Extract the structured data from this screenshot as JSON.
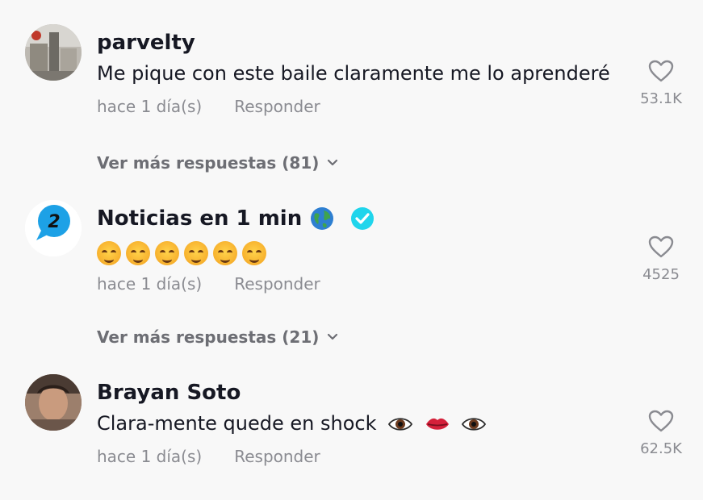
{
  "comments": [
    {
      "username": "parvelty",
      "text": "Me pique con este baile claramente me lo aprenderé",
      "time": "hace 1 día(s)",
      "reply_label": "Responder",
      "likes": "53.1K",
      "avatar": "photo-avatar",
      "more_replies": "Ver más respuestas (81)"
    },
    {
      "username": "Noticias en 1 min",
      "verified": true,
      "username_emoji": "globe-icon",
      "emoji_count": 6,
      "emoji": "smiling-face-with-hearts-icon",
      "time": "hace 1 día(s)",
      "reply_label": "Responder",
      "likes": "4525",
      "avatar": "speech-bubble-2-logo",
      "more_replies": "Ver más respuestas (21)"
    },
    {
      "username": "Brayan Soto",
      "text": "Clara-mente quede en shock",
      "text_emojis": [
        "eye-icon",
        "lips-icon",
        "eye-icon"
      ],
      "time": "hace 1 día(s)",
      "reply_label": "Responder",
      "likes": "62.5K",
      "avatar": "photo-avatar"
    }
  ],
  "colors": {
    "background": "#f8f8f8",
    "primary_text": "#161823",
    "secondary_text": "#8a8b91",
    "verified": "#20d5ec"
  }
}
